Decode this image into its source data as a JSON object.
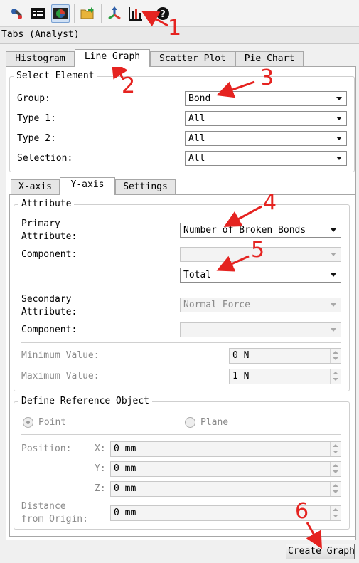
{
  "panel_title": "Tabs (Analyst)",
  "toolbar": {
    "buttons": [
      {
        "icon": "tools-icon"
      },
      {
        "icon": "list-view-icon"
      },
      {
        "icon": "pie-chart-view-icon",
        "active": true
      },
      {
        "icon": "open-folder-icon"
      },
      {
        "icon": "axes-icon"
      },
      {
        "icon": "bar-chart-icon"
      },
      {
        "icon": "help-icon",
        "glyph": "?"
      }
    ]
  },
  "main_tabs": [
    "Histogram",
    "Line Graph",
    "Scatter Plot",
    "Pie Chart"
  ],
  "selected_main_tab": "Line Graph",
  "select_element": {
    "title": "Select Element",
    "rows": [
      {
        "label": "Group:",
        "value": "Bond"
      },
      {
        "label": "Type 1:",
        "value": "All"
      },
      {
        "label": "Type 2:",
        "value": "All"
      },
      {
        "label": "Selection:",
        "value": "All"
      }
    ]
  },
  "axis_tabs": [
    "X-axis",
    "Y-axis",
    "Settings"
  ],
  "selected_axis_tab": "Y-axis",
  "attribute": {
    "title": "Attribute",
    "primary_label_line1": "Primary",
    "primary_label_line2": "Attribute:",
    "primary_value": "Number of Broken Bonds",
    "component_label": "Component:",
    "component_value": "",
    "component_sub_value": "Total",
    "secondary_label_line1": "Secondary",
    "secondary_label_line2": "Attribute:",
    "secondary_value": "Normal Force",
    "secondary_component_label": "Component:",
    "secondary_component_value": "",
    "min_label": "Minimum Value:",
    "min_value": "0 N",
    "max_label": "Maximum Value:",
    "max_value": "1 N"
  },
  "reference": {
    "title": "Define Reference Object",
    "point_label": "Point",
    "plane_label": "Plane",
    "position_label": "Position:",
    "x_label": "X:",
    "x_value": "0 mm",
    "y_label": "Y:",
    "y_value": "0 mm",
    "z_label": "Z:",
    "z_value": "0 mm",
    "distance_line1": "Distance",
    "distance_line2": "from Origin:",
    "distance_value": "0 mm"
  },
  "create_button": "Create Graph",
  "annotations": [
    "1",
    "2",
    "3",
    "4",
    "5",
    "6"
  ],
  "colors": {
    "annotation": "#e52320",
    "accent": "#7aa1d2"
  }
}
